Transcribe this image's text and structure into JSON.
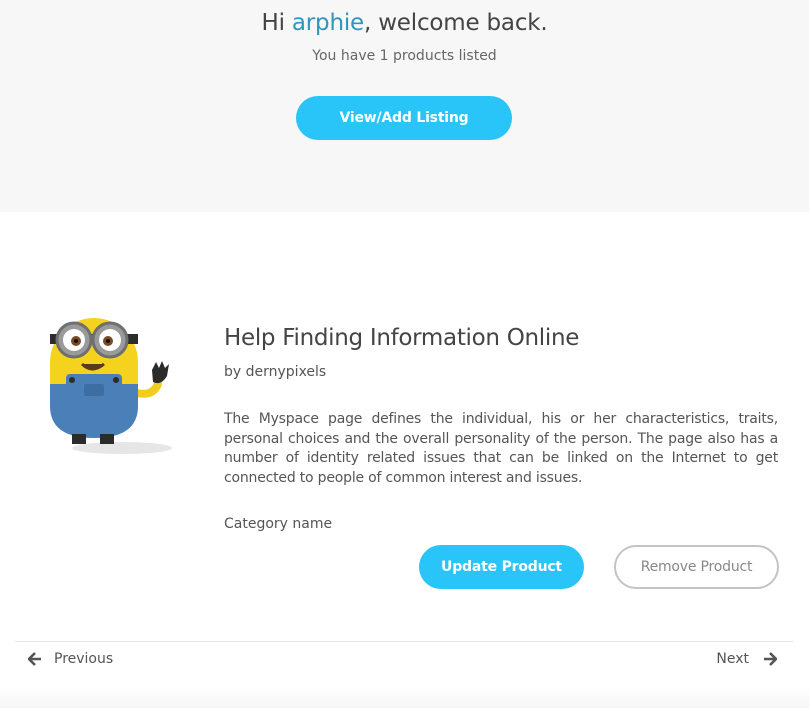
{
  "header": {
    "greeting_prefix": "Hi ",
    "username": "arphie",
    "greeting_suffix": ", welcome back.",
    "subtitle": "You have 1 products listed",
    "view_add_label": "View/Add Listing"
  },
  "product": {
    "title": "Help Finding Information Online",
    "author": "by dernypixels",
    "description": "The Myspace page defines the individual, his or her characteristics, traits, personal choices and the overall personality of the person. The page also has a number of identity related issues that can be linked on the Internet to get connected to people of common interest and issues.",
    "category": "Category name",
    "update_label": "Update Product",
    "remove_label": "Remove Product"
  },
  "pager": {
    "previous_label": "Previous",
    "next_label": "Next",
    "prev_icon": "arrow-left-icon",
    "next_icon": "arrow-right-icon"
  },
  "colors": {
    "accent": "#29c4f8",
    "username": "#2f95bf",
    "header_bg": "#f7f7f7"
  }
}
